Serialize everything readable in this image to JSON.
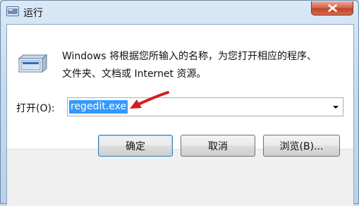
{
  "window": {
    "title": "运行",
    "icons": {
      "app": "run-dialog-icon",
      "close": "close-icon",
      "program": "run-program-icon"
    }
  },
  "dialog": {
    "description_line1": "Windows 将根据您所输入的名称，为您打开相应的程序、",
    "description_line2": "文件夹、文档或 Internet 资源。",
    "open_label": "打开(O):",
    "command_value": "regedit.exe",
    "annotation": "red-arrow-pointing-to-input"
  },
  "buttons": {
    "ok": "确定",
    "cancel": "取消",
    "browse": "浏览(B)..."
  },
  "colors": {
    "selection": "#3399ff",
    "annotation_arrow": "#d01f1f",
    "close_button": "#c2442b"
  }
}
